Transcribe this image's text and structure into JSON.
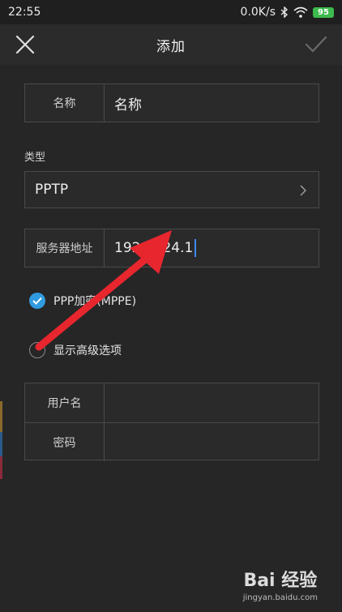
{
  "status_bar": {
    "time": "22:55",
    "network_speed": "0.0K/s",
    "battery": "95"
  },
  "header": {
    "title": "添加"
  },
  "form": {
    "name": {
      "label": "名称",
      "value": "名称"
    },
    "type_section_label": "类型",
    "type": {
      "value": "PPTP"
    },
    "server": {
      "label": "服务器地址",
      "value": "192.   .24.1"
    },
    "ppp_encryption": {
      "label": "PPP加密(MPPE)",
      "checked": true
    },
    "advanced_options": {
      "label": "显示高级选项",
      "checked": false
    },
    "username": {
      "label": "用户名",
      "value": ""
    },
    "password": {
      "label": "密码",
      "value": ""
    }
  },
  "watermark": {
    "brand": "Bai  经验",
    "url": "jingyan.baidu.com"
  },
  "colors": {
    "background": "#262626",
    "accent": "#2f9be0",
    "arrow": "#e8262e",
    "battery": "#3dbb4d"
  }
}
